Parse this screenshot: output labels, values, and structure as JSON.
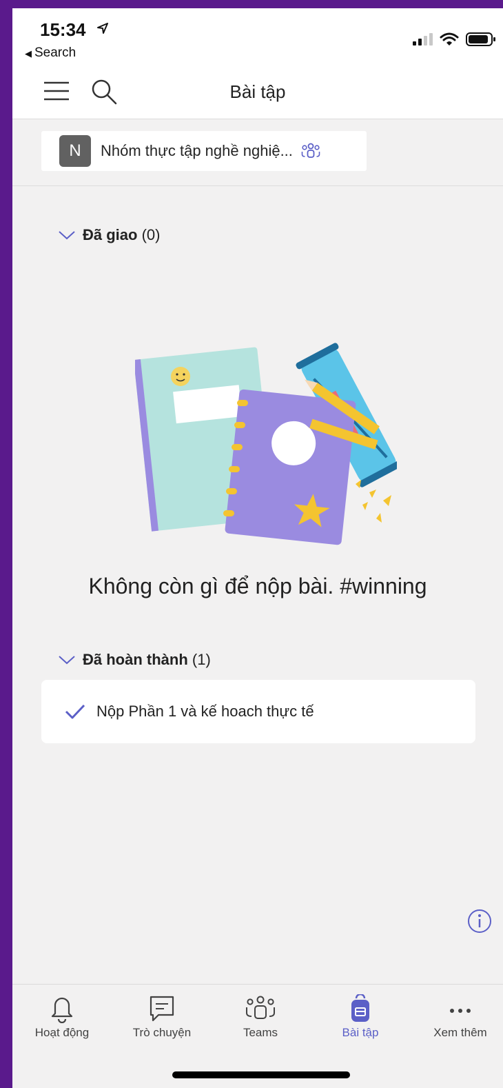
{
  "status_bar": {
    "time": "15:34",
    "back_label": "Search"
  },
  "header": {
    "title": "Bài tập"
  },
  "team": {
    "avatar_letter": "N",
    "name": "Nhóm thực tập nghề nghiệ..."
  },
  "sections": {
    "assigned": {
      "title": "Đã giao",
      "count": "(0)"
    },
    "empty_message": "Không còn gì để nộp bài. #winning",
    "completed": {
      "title": "Đã hoàn thành",
      "count": "(1)"
    }
  },
  "completed_items": [
    {
      "title": "Nộp Phần 1 và kế hoach thực tế"
    }
  ],
  "nav": {
    "items": [
      {
        "label": "Hoạt động",
        "icon": "bell-icon"
      },
      {
        "label": "Trò chuyện",
        "icon": "chat-icon"
      },
      {
        "label": "Teams",
        "icon": "teams-icon"
      },
      {
        "label": "Bài tập",
        "icon": "backpack-icon",
        "active": true
      },
      {
        "label": "Xem thêm",
        "icon": "more-icon"
      }
    ]
  },
  "colors": {
    "accent": "#5b5fc7",
    "frame": "#5a1a8c",
    "background": "#f2f1f1"
  }
}
